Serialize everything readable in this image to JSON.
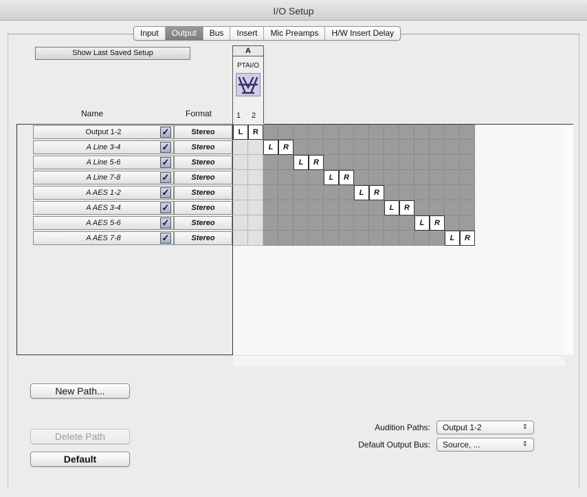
{
  "window": {
    "title": "I/O Setup"
  },
  "tabs": [
    {
      "label": "Input",
      "active": false
    },
    {
      "label": "Output",
      "active": true
    },
    {
      "label": "Bus",
      "active": false
    },
    {
      "label": "Insert",
      "active": false
    },
    {
      "label": "Mic Preamps",
      "active": false
    },
    {
      "label": "H/W Insert Delay",
      "active": false
    }
  ],
  "show_last_saved_label": "Show Last Saved Setup",
  "device": {
    "letter": "A",
    "name": "PTAI/O",
    "icon": "device-io-icon",
    "channels": [
      "1",
      "2"
    ]
  },
  "columns": {
    "name": "Name",
    "format": "Format"
  },
  "rows": [
    {
      "name": "Output 1-2",
      "checked": true,
      "format": "Stereo",
      "left": "L",
      "right": "R"
    },
    {
      "name": "A Line 3-4",
      "checked": true,
      "format": "Stereo",
      "left": "L",
      "right": "R"
    },
    {
      "name": "A Line 5-6",
      "checked": true,
      "format": "Stereo",
      "left": "L",
      "right": "R"
    },
    {
      "name": "A Line 7-8",
      "checked": true,
      "format": "Stereo",
      "left": "L",
      "right": "R"
    },
    {
      "name": "A AES 1-2",
      "checked": true,
      "format": "Stereo",
      "left": "L",
      "right": "R"
    },
    {
      "name": "A AES 3-4",
      "checked": true,
      "format": "Stereo",
      "left": "L",
      "right": "R"
    },
    {
      "name": "A AES 5-6",
      "checked": true,
      "format": "Stereo",
      "left": "L",
      "right": "R"
    },
    {
      "name": "A AES 7-8",
      "checked": true,
      "format": "Stereo",
      "left": "L",
      "right": "R"
    }
  ],
  "buttons": {
    "new_path": "New Path...",
    "delete_path": "Delete Path",
    "default": "Default"
  },
  "audition_paths": {
    "label": "Audition Paths:",
    "value": "Output 1-2"
  },
  "default_output_bus": {
    "label": "Default Output Bus:",
    "value": "Source, ..."
  },
  "colors": {
    "active_tab": "#8b8b8b",
    "grid_dark": "#9c9c9c",
    "grid_light": "#e1e1e1"
  }
}
